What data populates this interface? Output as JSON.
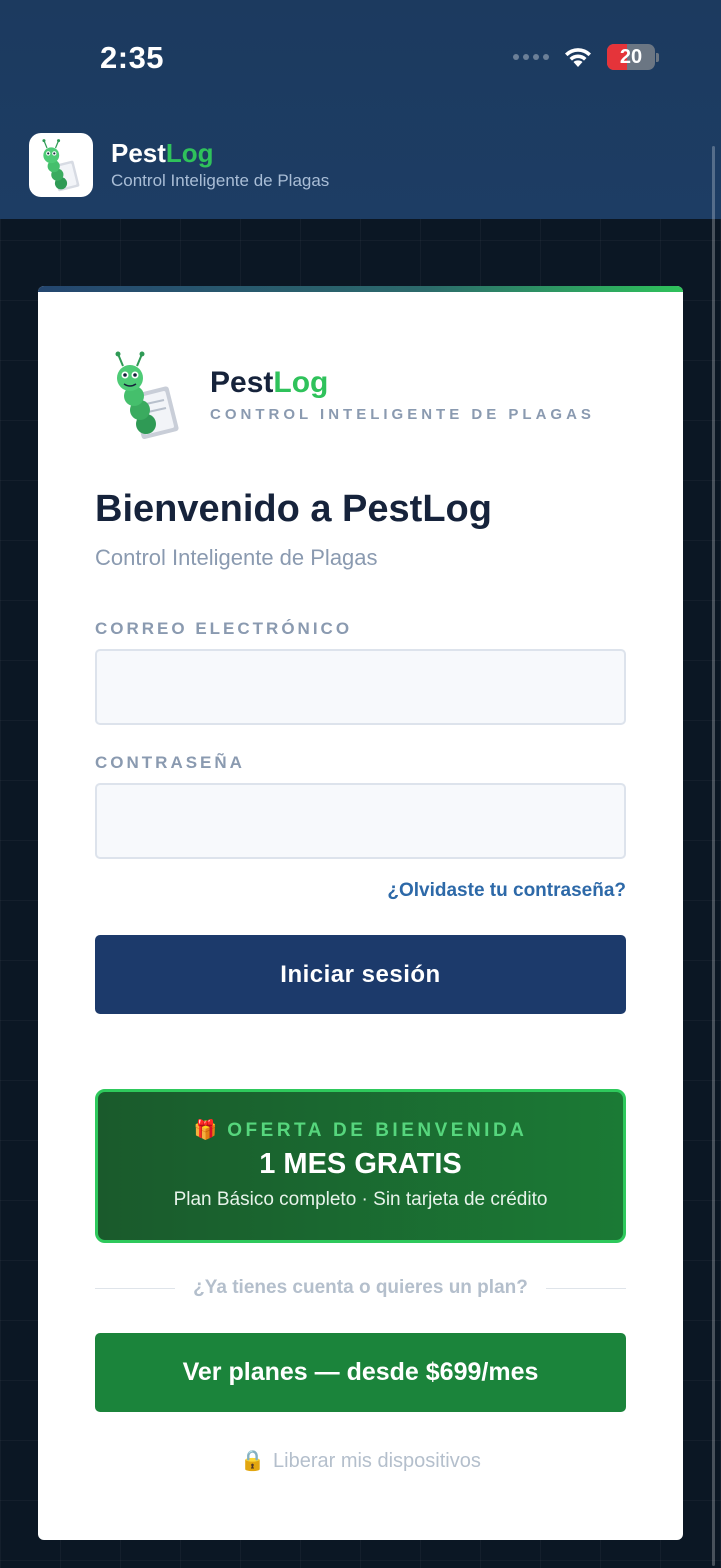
{
  "status_bar": {
    "time": "2:35",
    "battery": "20"
  },
  "header": {
    "app_name_part1": "Pest",
    "app_name_part2": "Log",
    "subtitle": "Control Inteligente de Plagas"
  },
  "card": {
    "brand_part1": "Pest",
    "brand_part2": "Log",
    "brand_tagline": "CONTROL INTELIGENTE DE PLAGAS",
    "title": "Bienvenido a PestLog",
    "subtitle": "Control Inteligente de Plagas",
    "email_label": "CORREO ELECTRÓNICO",
    "email_value": "",
    "password_label": "CONTRASEÑA",
    "password_value": "",
    "forgot_link": "¿Olvidaste tu contraseña?",
    "login_button": "Iniciar sesión",
    "offer": {
      "icon": "🎁",
      "label": "OFERTA DE BIENVENIDA",
      "title": "1 MES GRATIS",
      "subtitle": "Plan Básico completo · Sin tarjeta de crédito"
    },
    "divider_text": "¿Ya tienes cuenta o quieres un plan?",
    "plans_button": "Ver planes — desde $699/mes",
    "unlock_icon": "🔒",
    "unlock_link": "Liberar mis dispositivos"
  },
  "colors": {
    "header_bg": "#1c3a5f",
    "primary_button": "#1c3a6b",
    "accent_green": "#2fc25b",
    "plans_button": "#1b843b",
    "link_blue": "#2d69a8"
  }
}
